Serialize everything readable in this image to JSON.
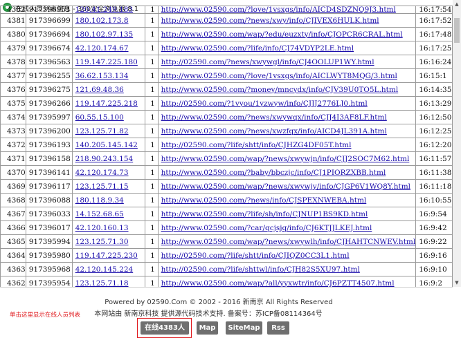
{
  "window": {
    "title": "在线人员列表信息 - 360安全浏览器 8.1"
  },
  "table": {
    "rows": [
      {
        "id": "4382",
        "num": "917396951",
        "ip": "120.41.249.183",
        "one": "1",
        "url": "http://www.02590.com/?love/1vsxgs/info/AICD4SDZNQ9J3.html",
        "time": "16:17:54"
      },
      {
        "id": "4381",
        "num": "917396699",
        "ip": "180.102.173.8",
        "one": "1",
        "url": "http://www.02590.com/?news/xwy/info/CJIVEX6HULK.html",
        "time": "16:17:52"
      },
      {
        "id": "4380",
        "num": "917396694",
        "ip": "180.102.97.135",
        "one": "1",
        "url": "http://www.02590.com/wap/?edu/euzxty/info/CJOPCR6CRAL.html",
        "time": "16:17:48"
      },
      {
        "id": "4379",
        "num": "917396674",
        "ip": "42.120.174.67",
        "one": "1",
        "url": "http://www.02590.com/?life/info/CJ74VDYP2LE.html",
        "time": "16:17:25"
      },
      {
        "id": "4378",
        "num": "917396563",
        "ip": "119.147.225.180",
        "one": "1",
        "url": "http://02590.com/?news/xwywgl/info/CJ4OOLUP1WY.html",
        "time": "16:16:24"
      },
      {
        "id": "4377",
        "num": "917396255",
        "ip": "36.62.153.134",
        "one": "1",
        "url": "http://www.02590.com/?love/1vsxgs/info/AICLWYT8MQG/3.html",
        "time": "16:15:1"
      },
      {
        "id": "4376",
        "num": "917396275",
        "ip": "121.69.48.36",
        "one": "1",
        "url": "http://www.02590.com/?money/mncydx/info/CJV39U0TO5L.html",
        "time": "16:14:35"
      },
      {
        "id": "4375",
        "num": "917396266",
        "ip": "119.147.225.218",
        "one": "1",
        "url": "http://02590.com/?1vyou/1yzwyw/info/CJJJ2776LJ0.html",
        "time": "16:13:29"
      },
      {
        "id": "4374",
        "num": "917395997",
        "ip": "60.55.15.100",
        "one": "1",
        "url": "http://www.02590.com/?news/xwywqx/info/CJJ4I3AF8LF.html",
        "time": "16:12:50"
      },
      {
        "id": "4373",
        "num": "917396200",
        "ip": "123.125.71.82",
        "one": "1",
        "url": "http://www.02590.com/?news/xwzfqx/info/AICD4JL391A.html",
        "time": "16:12:25"
      },
      {
        "id": "4372",
        "num": "917396193",
        "ip": "140.205.145.142",
        "one": "1",
        "url": "http://02590.com/?life/shtt/info/CJHZG4DF05T.html",
        "time": "16:12:20"
      },
      {
        "id": "4371",
        "num": "917396158",
        "ip": "218.90.243.154",
        "one": "1",
        "url": "http://www.02590.com/wap/?news/xwywjn/info/CJJ2SOC7M62.html",
        "time": "16:11:57"
      },
      {
        "id": "4370",
        "num": "917396141",
        "ip": "42.120.174.73",
        "one": "1",
        "url": "http://www.02590.com/?baby/bbczjc/info/CJ1PIORZXBB.html",
        "time": "16:11:38"
      },
      {
        "id": "4369",
        "num": "917396117",
        "ip": "123.125.71.15",
        "one": "1",
        "url": "http://www.02590.com/wap/?news/xwywjy/info/CJGP6V1WQ8Y.html",
        "time": "16:11:18"
      },
      {
        "id": "4368",
        "num": "917396088",
        "ip": "180.118.9.34",
        "one": "1",
        "url": "http://www.02590.com/?news/info/CJSPEXNWEBA.html",
        "time": "16:10:55"
      },
      {
        "id": "4367",
        "num": "917396033",
        "ip": "14.152.68.65",
        "one": "1",
        "url": "http://www.02590.com/?life/sh/info/CJNUP1BS9KD.html",
        "time": "16:9:54"
      },
      {
        "id": "4366",
        "num": "917396017",
        "ip": "42.120.160.13",
        "one": "1",
        "url": "http://www.02590.com/?car/qcjsjq/info/CJ6KTJJLKEJ.html",
        "time": "16:9:42"
      },
      {
        "id": "4365",
        "num": "917395994",
        "ip": "123.125.71.30",
        "one": "1",
        "url": "http://www.02590.com/wap/?news/xwywlh/info/CJHAHTCNWEV.html",
        "time": "16:9:22"
      },
      {
        "id": "4364",
        "num": "917395980",
        "ip": "119.147.225.230",
        "one": "1",
        "url": "http://02590.com/?life/shtt/info/CJIQZ0CC3L1.html",
        "time": "16:9:16"
      },
      {
        "id": "4363",
        "num": "917395968",
        "ip": "42.120.145.224",
        "one": "1",
        "url": "http://02590.com/?life/shttwl/info/CJH82S5XU97.html",
        "time": "16:9:10"
      },
      {
        "id": "4362",
        "num": "917395954",
        "ip": "123.125.71.18",
        "one": "1",
        "url": "http://www.02590.com/wap/?all/yyxwtr/info/CJ6PZTT4507.html",
        "time": "16:9:2"
      }
    ]
  },
  "footer": {
    "powered": "Powered by 02590.Com ©  2002 - 2016  新南京 All Rights Reserved",
    "support": "本网站由 新南京科技 提供源代码技术支持. 备案号：苏ICP备08114364号",
    "annotation": "单击这里显示在线人员列表",
    "buttons": {
      "online": "在线4383人",
      "map": "Map",
      "sitemap": "SiteMap",
      "rss": "Rss"
    }
  },
  "colors": {
    "link": "#1a0dab",
    "button_bg": "#6f6f6f",
    "highlight": "#e0191d"
  }
}
